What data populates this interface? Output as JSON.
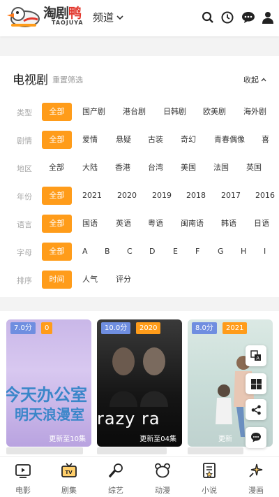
{
  "app": {
    "logo_text_dark": "淘剧",
    "logo_text_red": "鸭",
    "logo_sub": "TAOJUYA",
    "channel_label": "频道"
  },
  "filter": {
    "title": "电视剧",
    "reset_label": "重置筛选",
    "collapse_label": "收起",
    "rows": [
      {
        "label": "类型",
        "options": [
          "全部",
          "国产剧",
          "港台剧",
          "日韩剧",
          "欧美剧",
          "海外剧"
        ],
        "active": 0
      },
      {
        "label": "剧情",
        "options": [
          "全部",
          "爱情",
          "悬疑",
          "古装",
          "奇幻",
          "青春偶像",
          "喜"
        ],
        "active": 0
      },
      {
        "label": "地区",
        "options": [
          "全部",
          "大陆",
          "香港",
          "台湾",
          "美国",
          "法国",
          "英国"
        ],
        "active": -1
      },
      {
        "label": "年份",
        "options": [
          "全部",
          "2021",
          "2020",
          "2019",
          "2018",
          "2017",
          "2016"
        ],
        "active": 0
      },
      {
        "label": "语言",
        "options": [
          "全部",
          "国语",
          "英语",
          "粤语",
          "闽南语",
          "韩语",
          "日语"
        ],
        "active": 0
      },
      {
        "label": "字母",
        "options": [
          "全部",
          "A",
          "B",
          "C",
          "D",
          "E",
          "F",
          "G",
          "H",
          "I"
        ],
        "active": 0
      },
      {
        "label": "排序",
        "options": [
          "时间",
          "人气",
          "评分"
        ],
        "active": 0
      }
    ]
  },
  "cards": [
    {
      "score": "7.0分",
      "year": "0",
      "update": "更新至10集",
      "poster_line1": "今天办公室",
      "poster_line2": "明天浪漫室"
    },
    {
      "score": "10.0分",
      "year": "2020",
      "update": "更新至04集",
      "poster_line1": "razy ra"
    },
    {
      "score": "8.0分",
      "year": "2021",
      "update": "更新"
    }
  ],
  "bottom_nav": [
    {
      "label": "电影",
      "icon": "movie-icon"
    },
    {
      "label": "剧集",
      "icon": "tv-icon"
    },
    {
      "label": "综艺",
      "icon": "microphone-icon"
    },
    {
      "label": "动漫",
      "icon": "bear-icon"
    },
    {
      "label": "小说",
      "icon": "book-icon"
    },
    {
      "label": "漫画",
      "icon": "sparkle-icon"
    }
  ],
  "colors": {
    "accent": "#ff9c1a",
    "score_badge": "#6f8ee0",
    "brand_red": "#e2362c"
  }
}
